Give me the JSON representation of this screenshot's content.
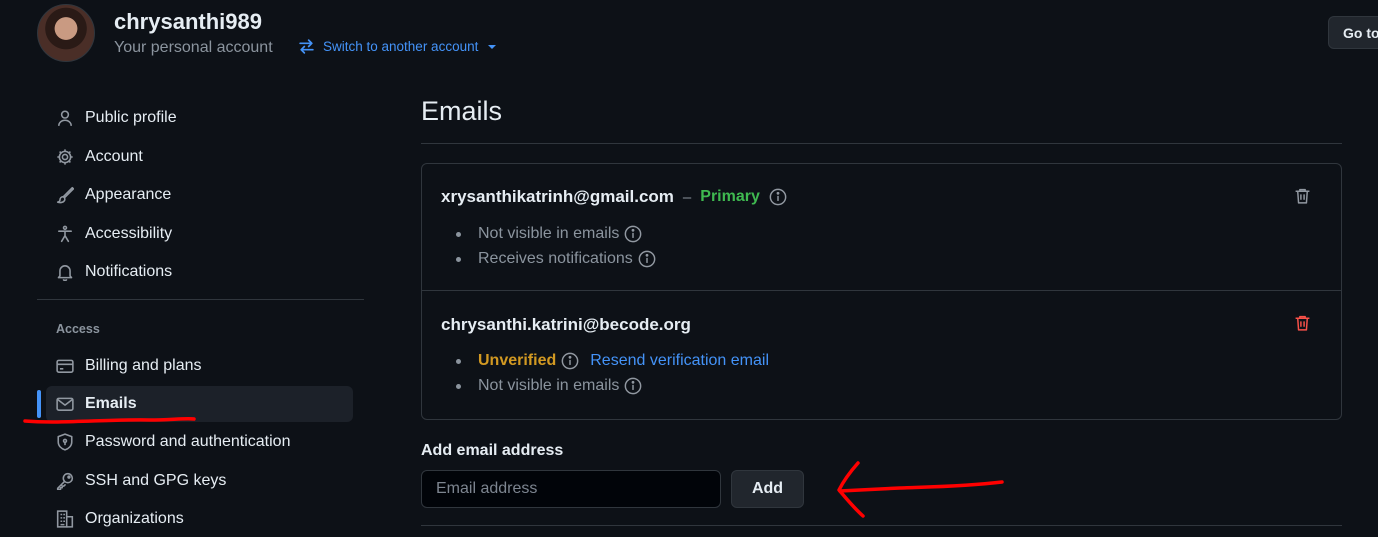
{
  "header": {
    "username": "chrysanthi989",
    "subtitle": "Your personal account",
    "switch_label": "Switch to another account",
    "goto_label": "Go to"
  },
  "sidebar": {
    "items": [
      {
        "label": "Public profile",
        "icon": "person-icon"
      },
      {
        "label": "Account",
        "icon": "gear-icon"
      },
      {
        "label": "Appearance",
        "icon": "paintbrush-icon"
      },
      {
        "label": "Accessibility",
        "icon": "accessibility-icon"
      },
      {
        "label": "Notifications",
        "icon": "bell-icon"
      }
    ],
    "access_section_label": "Access",
    "access_items": [
      {
        "label": "Billing and plans",
        "icon": "credit-card-icon"
      },
      {
        "label": "Emails",
        "icon": "mail-icon",
        "active": true
      },
      {
        "label": "Password and authentication",
        "icon": "shield-lock-icon"
      },
      {
        "label": "SSH and GPG keys",
        "icon": "key-icon"
      },
      {
        "label": "Organizations",
        "icon": "organization-icon"
      }
    ]
  },
  "main": {
    "title": "Emails",
    "emails": [
      {
        "address": "xrysanthikatrinh@gmail.com",
        "separator": "–",
        "status": "Primary",
        "details": [
          "Not visible in emails",
          "Receives notifications"
        ]
      },
      {
        "address": "chrysanthi.katrini@becode.org",
        "status": "Unverified",
        "resend_label": "Resend verification email",
        "details": [
          "Not visible in emails"
        ]
      }
    ],
    "add_email": {
      "label": "Add email address",
      "placeholder": "Email address",
      "value": "",
      "button_label": "Add"
    }
  },
  "colors": {
    "background": "#0d1117",
    "accent": "#4493f8",
    "primary_status": "#3fb950",
    "unverified_status": "#d29922",
    "danger": "#f85149",
    "annotation": "#ff0000"
  }
}
